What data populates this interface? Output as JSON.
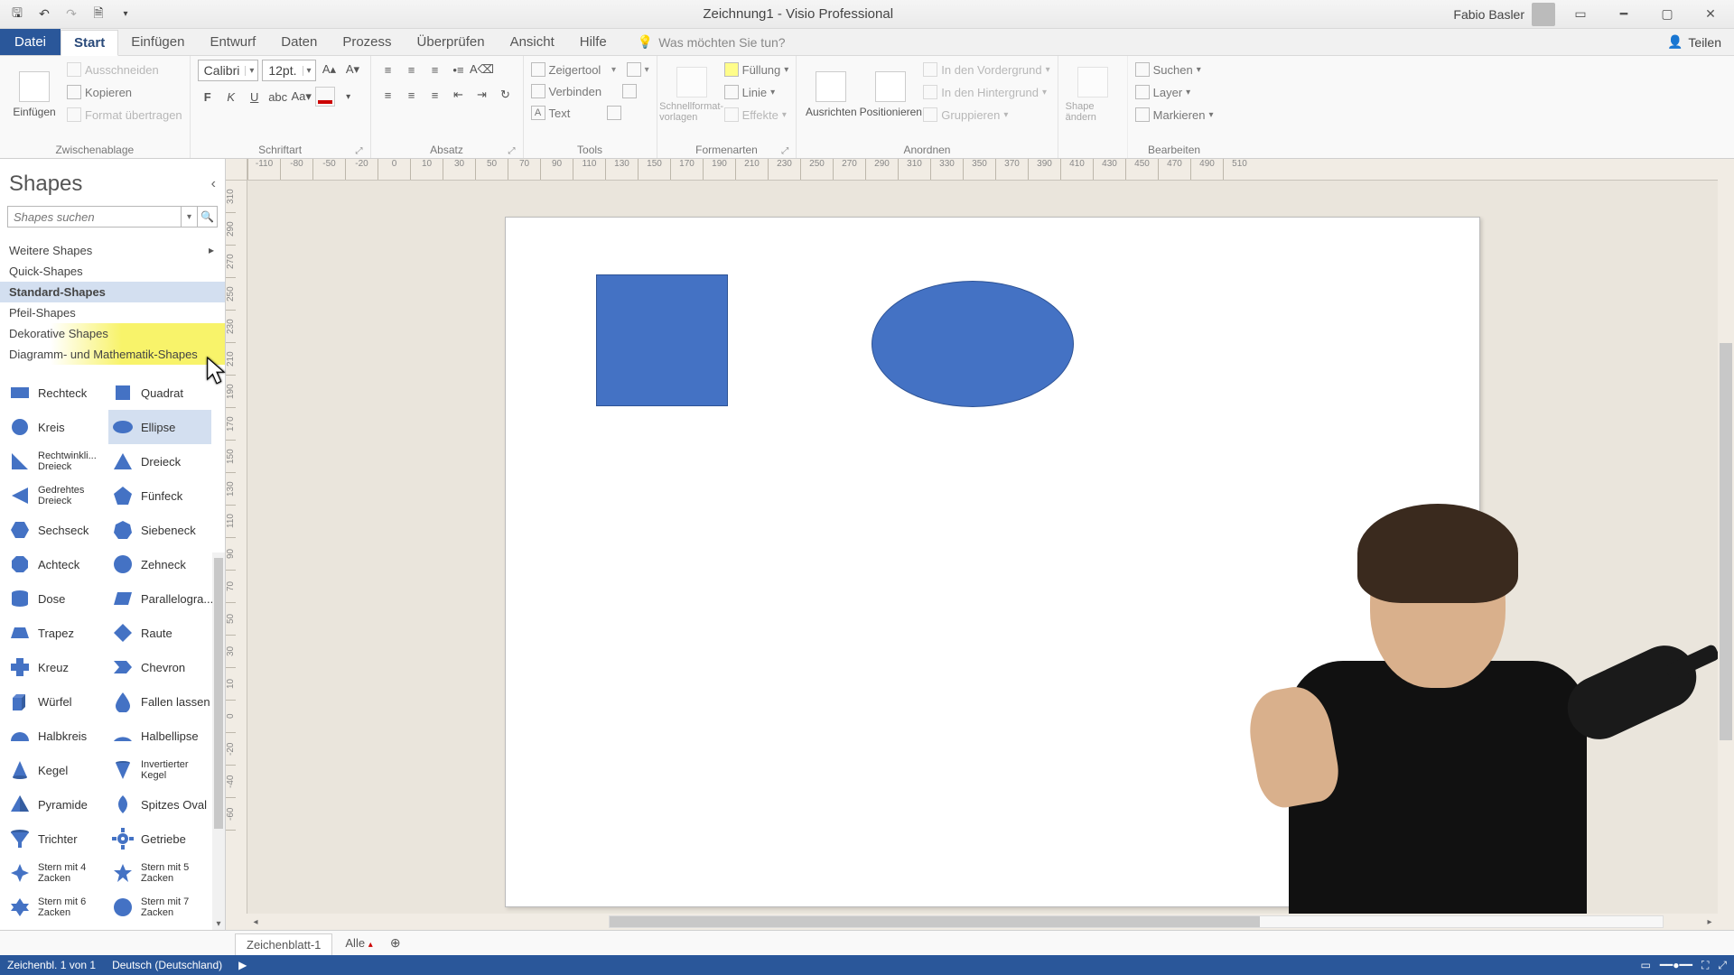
{
  "titlebar": {
    "doc": "Zeichnung1",
    "app": "Visio Professional",
    "separator": " - ",
    "user": "Fabio Basler"
  },
  "ribbon_tabs": {
    "file": "Datei",
    "start": "Start",
    "einfuegen": "Einfügen",
    "entwurf": "Entwurf",
    "daten": "Daten",
    "prozess": "Prozess",
    "ueberpruefen": "Überprüfen",
    "ansicht": "Ansicht",
    "hilfe": "Hilfe",
    "tell_me": "Was möchten Sie tun?",
    "share": "Teilen"
  },
  "ribbon": {
    "clipboard": {
      "paste": "Einfügen",
      "cut": "Ausschneiden",
      "copy": "Kopieren",
      "format_painter": "Format übertragen",
      "label": "Zwischenablage"
    },
    "font": {
      "name": "Calibri",
      "size": "12pt.",
      "label": "Schriftart"
    },
    "paragraph": {
      "label": "Absatz"
    },
    "tools": {
      "pointer": "Zeigertool",
      "connector": "Verbinden",
      "text": "Text",
      "label": "Tools"
    },
    "shape_styles": {
      "quick": "Schnellformat-vorlagen",
      "fill": "Füllung",
      "line": "Linie",
      "effects": "Effekte",
      "label": "Formenarten"
    },
    "arrange": {
      "align": "Ausrichten",
      "position": "Positionieren",
      "front": "In den Vordergrund",
      "back": "In den Hintergrund",
      "group": "Gruppieren",
      "label": "Anordnen"
    },
    "edit_shape": {
      "change": "Shape ändern",
      "label": ""
    },
    "editing": {
      "find": "Suchen",
      "layer": "Layer",
      "select": "Markieren",
      "label": "Bearbeiten"
    }
  },
  "shapes_pane": {
    "title": "Shapes",
    "search_placeholder": "Shapes suchen",
    "more": "Weitere Shapes",
    "categories": {
      "quick": "Quick-Shapes",
      "standard": "Standard-Shapes",
      "pfeil": "Pfeil-Shapes",
      "dekorative": "Dekorative Shapes",
      "diagramm": "Diagramm- und Mathematik-Shapes"
    },
    "shapes": [
      [
        "Rechteck",
        "Quadrat"
      ],
      [
        "Kreis",
        "Ellipse"
      ],
      [
        "Rechtwinkli... Dreieck",
        "Dreieck"
      ],
      [
        "Gedrehtes Dreieck",
        "Fünfeck"
      ],
      [
        "Sechseck",
        "Siebeneck"
      ],
      [
        "Achteck",
        "Zehneck"
      ],
      [
        "Dose",
        "Parallelogra..."
      ],
      [
        "Trapez",
        "Raute"
      ],
      [
        "Kreuz",
        "Chevron"
      ],
      [
        "Würfel",
        "Fallen lassen"
      ],
      [
        "Halbkreis",
        "Halbellipse"
      ],
      [
        "Kegel",
        "Invertierter Kegel"
      ],
      [
        "Pyramide",
        "Spitzes Oval"
      ],
      [
        "Trichter",
        "Getriebe"
      ],
      [
        "Stern mit 4 Zacken",
        "Stern mit 5 Zacken"
      ],
      [
        "Stern mit 6 Zacken",
        "Stern mit 7 Zacken"
      ]
    ]
  },
  "ruler_h": [
    "-110",
    "-80",
    "-50",
    "-20",
    "0",
    "10",
    "30",
    "50",
    "70",
    "90",
    "110",
    "130",
    "150",
    "170",
    "190",
    "210",
    "230",
    "250",
    "270",
    "290",
    "310",
    "330",
    "350",
    "370",
    "390",
    "410",
    "430",
    "450",
    "470",
    "490",
    "510"
  ],
  "ruler_v": [
    "310",
    "290",
    "270",
    "250",
    "230",
    "210",
    "190",
    "170",
    "150",
    "130",
    "110",
    "90",
    "70",
    "50",
    "30",
    "10",
    "0",
    "-20",
    "-40",
    "-60"
  ],
  "sheet_tabs": {
    "sheet1": "Zeichenblatt-1",
    "all": "Alle"
  },
  "status": {
    "page_info": "Zeichenbl. 1 von 1",
    "lang": "Deutsch (Deutschland)"
  }
}
